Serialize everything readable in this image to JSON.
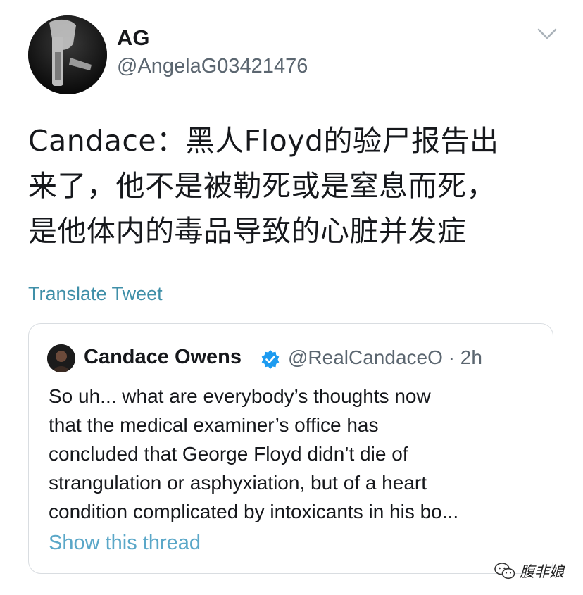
{
  "tweet": {
    "author_name": "AG",
    "author_handle": "@AngelaG03421476",
    "text": "Candace：黑人Floyd的验尸报告出\n来了，他不是被勒死或是窒息而死，\n是他体内的毒品导致的心脏并发症",
    "translate_label": "Translate Tweet",
    "menu_icon": "chevron-down-icon"
  },
  "quoted_tweet": {
    "author_name": "Candace Owens",
    "verified_icon": "verified-badge-icon",
    "handle_and_time": "@RealCandaceO · 2h",
    "text": "So uh... what are everybody’s thoughts now\nthat the medical examiner’s office has\nconcluded that George Floyd didn’t die of\nstrangulation or asphyxiation, but of a heart\ncondition complicated by intoxicants in his bo...",
    "show_thread_label": "Show this thread"
  },
  "watermark": {
    "icon": "wechat-icon",
    "text": "腹非娘"
  },
  "colors": {
    "link": "#3f8fa8",
    "verified": "#1d9bf0",
    "secondary_text": "#5b6670",
    "border": "#d9dde1"
  }
}
